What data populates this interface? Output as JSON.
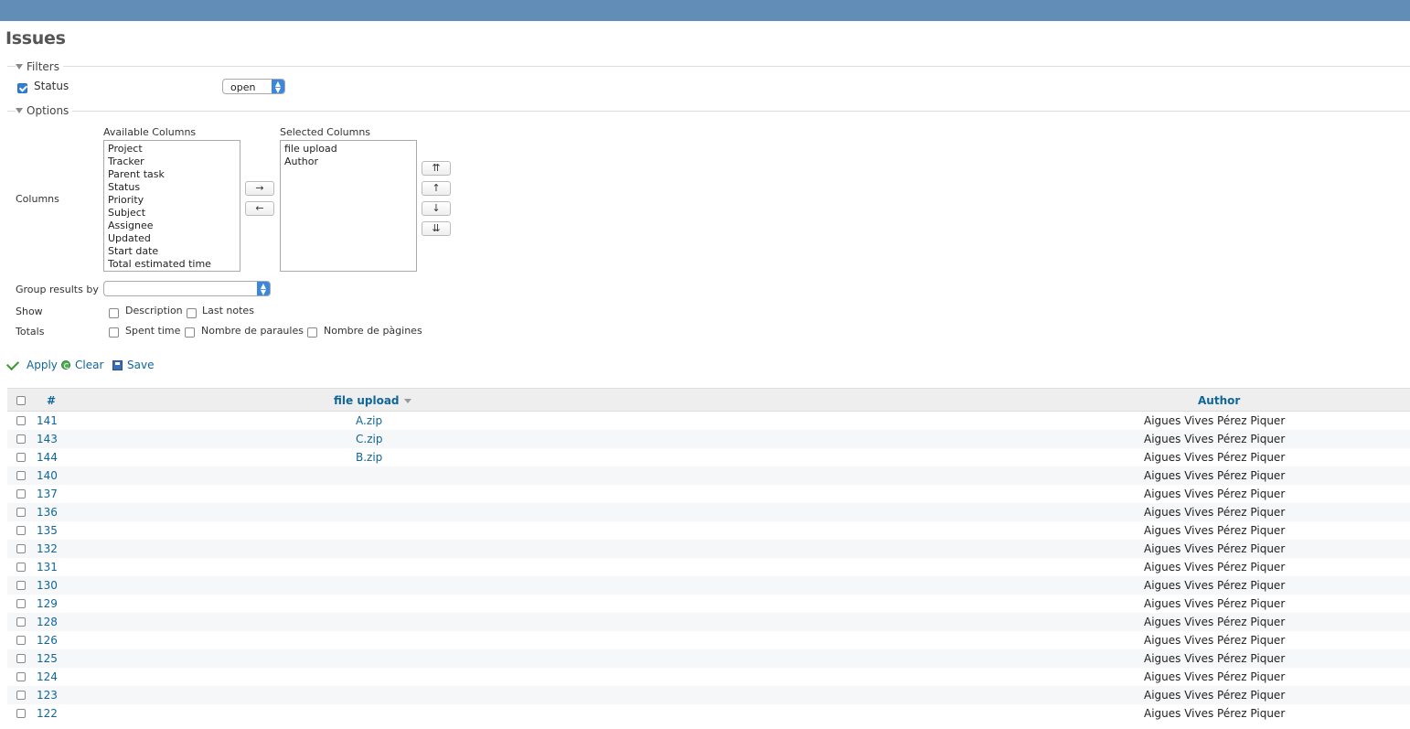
{
  "page": {
    "title": "Issues"
  },
  "filters": {
    "legend": "Filters",
    "status_label": "Status",
    "status_value": "open"
  },
  "options": {
    "legend": "Options",
    "columns_label": "Columns",
    "available_title": "Available Columns",
    "available": [
      "Project",
      "Tracker",
      "Parent task",
      "Status",
      "Priority",
      "Subject",
      "Assignee",
      "Updated",
      "Start date",
      "Total estimated time"
    ],
    "selected_title": "Selected Columns",
    "selected": [
      "file upload",
      "Author"
    ],
    "move_right": "→",
    "move_left": "←",
    "move_top": "⇈",
    "move_up": "↑",
    "move_down": "↓",
    "move_bottom": "⇊",
    "group_label": "Group results by",
    "group_value": "",
    "show_label": "Show",
    "show_description": "Description",
    "show_last_notes": "Last notes",
    "totals_label": "Totals",
    "totals_spent": "Spent time",
    "totals_words": "Nombre de paraules",
    "totals_pages": "Nombre de pàgines"
  },
  "actions": {
    "apply": "Apply",
    "clear": "Clear",
    "save": "Save"
  },
  "table": {
    "col_id": "#",
    "col_file": "file upload",
    "col_author": "Author",
    "rows": [
      {
        "id": "141",
        "file": "A.zip",
        "author": "Aigues Vives Pérez Piquer"
      },
      {
        "id": "143",
        "file": "C.zip",
        "author": "Aigues Vives Pérez Piquer"
      },
      {
        "id": "144",
        "file": "B.zip",
        "author": "Aigues Vives Pérez Piquer"
      },
      {
        "id": "140",
        "file": "",
        "author": "Aigues Vives Pérez Piquer"
      },
      {
        "id": "137",
        "file": "",
        "author": "Aigues Vives Pérez Piquer"
      },
      {
        "id": "136",
        "file": "",
        "author": "Aigues Vives Pérez Piquer"
      },
      {
        "id": "135",
        "file": "",
        "author": "Aigues Vives Pérez Piquer"
      },
      {
        "id": "132",
        "file": "",
        "author": "Aigues Vives Pérez Piquer"
      },
      {
        "id": "131",
        "file": "",
        "author": "Aigues Vives Pérez Piquer"
      },
      {
        "id": "130",
        "file": "",
        "author": "Aigues Vives Pérez Piquer"
      },
      {
        "id": "129",
        "file": "",
        "author": "Aigues Vives Pérez Piquer"
      },
      {
        "id": "128",
        "file": "",
        "author": "Aigues Vives Pérez Piquer"
      },
      {
        "id": "126",
        "file": "",
        "author": "Aigues Vives Pérez Piquer"
      },
      {
        "id": "125",
        "file": "",
        "author": "Aigues Vives Pérez Piquer"
      },
      {
        "id": "124",
        "file": "",
        "author": "Aigues Vives Pérez Piquer"
      },
      {
        "id": "123",
        "file": "",
        "author": "Aigues Vives Pérez Piquer"
      },
      {
        "id": "122",
        "file": "",
        "author": "Aigues Vives Pérez Piquer"
      }
    ]
  }
}
